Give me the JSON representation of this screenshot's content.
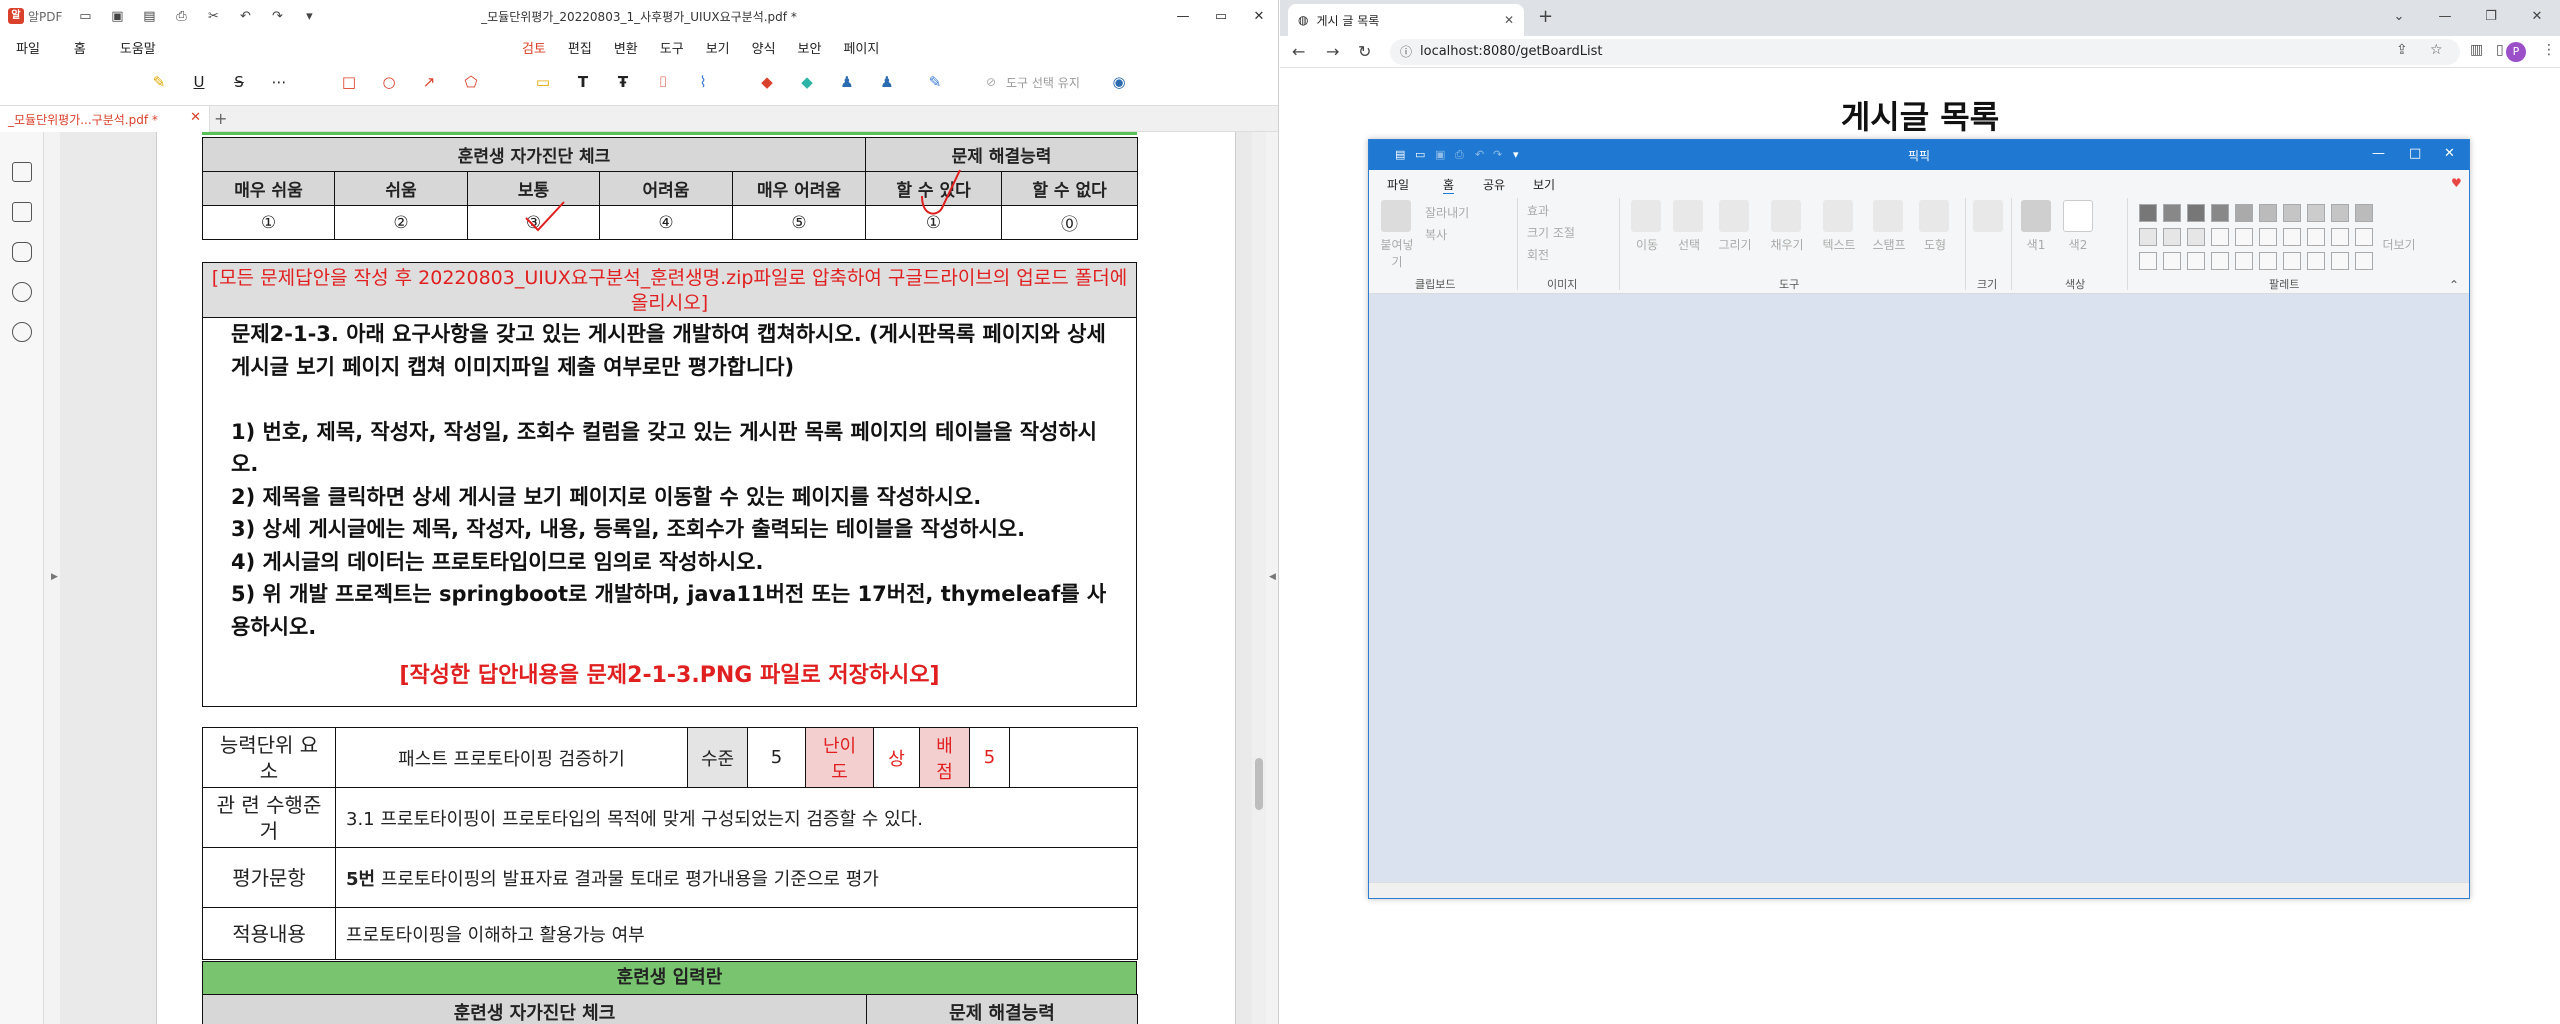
{
  "pdf": {
    "app_name": "알PDF",
    "window_title": "_모듈단위평가_20220803_1_사후평가_UIUX요구분석.pdf *",
    "menu_left": [
      "파일",
      "홈",
      "도움말"
    ],
    "menu_center": [
      "검토",
      "편집",
      "변환",
      "도구",
      "보기",
      "양식",
      "보안",
      "페이지"
    ],
    "toolbar_keep_tool": "도구 선택 유지",
    "doc_tab": "_모듈단위평가...구분석.pdf *",
    "table_top": {
      "header_left": "훈련생 자가진단 체크",
      "header_right": "문제 해결능력",
      "levels": [
        "매우 쉬움",
        "쉬움",
        "보통",
        "어려움",
        "매우 어려움"
      ],
      "ability": [
        "할 수 있다",
        "할 수 없다"
      ],
      "marks": [
        "①",
        "②",
        "③",
        "④",
        "⑤",
        "①",
        "⓪"
      ]
    },
    "notice": "[모든 문제답안을 작성 후 20220803_UIUX요구분석_훈련생명.zip파일로 압축하여 구글드라이브의 업로드 폴더에 올리시오]",
    "question": "문제2-1-3. 아래 요구사항을 갖고 있는 게시판을 개발하여 캡쳐하시오. (게시판목록 페이지와 상세 게시글 보기 페이지 캡쳐 이미지파일 제출 여부로만 평가합니다)\n\n1) 번호, 제목, 작성자, 작성일, 조회수 컬럼을 갖고 있는 게시판 목록 페이지의 테이블을 작성하시오.\n2) 제목을 클릭하면 상세 게시글 보기 페이지로 이동할 수 있는 페이지를 작성하시오.\n3) 상세 게시글에는 제목, 작성자, 내용, 등록일, 조회수가 출력되는 테이블을 작성하시오.\n4) 게시글의 데이터는 프로토타입이므로 임의로 작성하시오.\n5) 위 개발 프로젝트는 springboot로 개발하며, java11버전 또는 17버전, thymeleaf를 사용하시오.",
    "save_instruction": "[작성한 답안내용을 문제2-1-3.PNG 파일로 저장하시오]",
    "info": {
      "unit_label": "능력단위 요 소",
      "unit_value": "패스트 프로토타이핑 검증하기",
      "level_label": "수준",
      "level_value": "5",
      "difficulty_label": "난이도",
      "difficulty_value": "상",
      "score_label": "배점",
      "score_value": "5",
      "criteria_label": "관 련 수행준거",
      "criteria_value": "3.1 프로토타이핑이 프로토타입의 목적에 맞게 구성되었는지 검증할 수 있다.",
      "eval_label": "평가문항",
      "eval_bold": "5번",
      "eval_value": "프로토타이핑의 발표자료 결과물 토대로 평가내용을 기준으로 평가",
      "apply_label": "적용내용",
      "apply_value": "프로토타이핑을 이해하고 활용가능 여부"
    },
    "input_bar": "훈련생 입력란",
    "table_bottom": {
      "header_left": "훈련생 자가진단 체크",
      "header_right": "문제 해결능력"
    }
  },
  "browser": {
    "tab_title": "게시 글 목록",
    "url": "localhost:8080/getBoardList",
    "avatar_letter": "P",
    "heading": "게시글 목록"
  },
  "paint": {
    "title": "픽픽",
    "menu": [
      "파일",
      "홈",
      "공유",
      "보기"
    ],
    "groups": [
      "클립보드",
      "이미지",
      "도구",
      "크기",
      "색상",
      "팔레트"
    ],
    "clipboard": [
      "붙여넣기",
      "잘라내기",
      "복사"
    ],
    "image": [
      "효과",
      "크기 조절",
      "회전"
    ],
    "tools": [
      "이동",
      "선택",
      "그리기",
      "채우기",
      "텍스트",
      "스탬프",
      "도형"
    ],
    "colors": [
      "색1",
      "색2"
    ],
    "more": "더보기"
  },
  "colors": {
    "accent_red": "#d9412c",
    "notice_red": "#e02020",
    "header_green": "#79c56f",
    "paint_blue": "#1f78d1"
  }
}
